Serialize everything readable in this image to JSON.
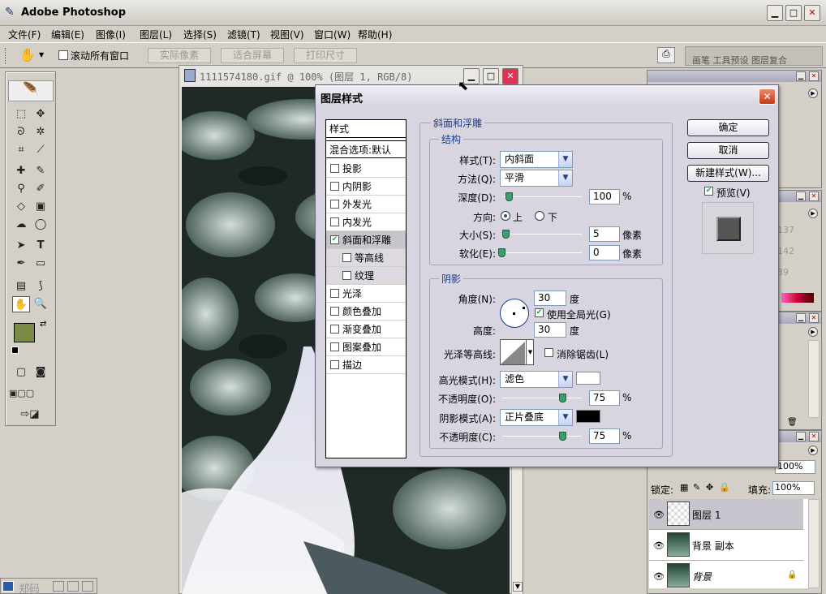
{
  "app": {
    "title": "Adobe Photoshop"
  },
  "menu": [
    "文件(F)",
    "编辑(E)",
    "图像(I)",
    "图层(L)",
    "选择(S)",
    "滤镜(T)",
    "视图(V)",
    "窗口(W)",
    "帮助(H)"
  ],
  "options": {
    "scroll_all": "滚动所有窗口",
    "actual_pixels": "实际像素",
    "fit_screen": "适合屏幕",
    "print_size": "打印尺寸"
  },
  "palette_tabs": "画笔 工具预设 图层复合",
  "document": {
    "title": "1111574180.gif @ 100% (图层 1, RGB/8)"
  },
  "dialog": {
    "title": "图层样式",
    "styles_header": "样式",
    "blend_options": "混合选项:默认",
    "effects": [
      {
        "label": "投影",
        "checked": false
      },
      {
        "label": "内阴影",
        "checked": false
      },
      {
        "label": "外发光",
        "checked": false
      },
      {
        "label": "内发光",
        "checked": false
      },
      {
        "label": "斜面和浮雕",
        "checked": true
      },
      {
        "label": "等高线",
        "checked": false
      },
      {
        "label": "纹理",
        "checked": false
      },
      {
        "label": "光泽",
        "checked": false
      },
      {
        "label": "颜色叠加",
        "checked": false
      },
      {
        "label": "渐变叠加",
        "checked": false
      },
      {
        "label": "图案叠加",
        "checked": false
      },
      {
        "label": "描边",
        "checked": false
      }
    ],
    "section_title": "斜面和浮雕",
    "structure": {
      "title": "结构",
      "style_label": "样式(T):",
      "style_value": "内斜面",
      "technique_label": "方法(Q):",
      "technique_value": "平滑",
      "depth_label": "深度(D):",
      "depth_value": "100",
      "depth_unit": "%",
      "direction_label": "方向:",
      "dir_up": "上",
      "dir_down": "下",
      "size_label": "大小(S):",
      "size_value": "5",
      "size_unit": "像素",
      "soften_label": "软化(E):",
      "soften_value": "0",
      "soften_unit": "像素"
    },
    "shading": {
      "title": "阴影",
      "angle_label": "角度(N):",
      "angle_value": "30",
      "angle_unit": "度",
      "global_light": "使用全局光(G)",
      "altitude_label": "高度:",
      "altitude_value": "30",
      "altitude_unit": "度",
      "gloss_label": "光泽等高线:",
      "anti_alias": "消除锯齿(L)",
      "highlight_label": "高光模式(H):",
      "highlight_value": "滤色",
      "hl_opacity_label": "不透明度(O):",
      "hl_opacity_value": "75",
      "hl_opacity_unit": "%",
      "shadow_label": "阴影模式(A):",
      "shadow_value": "正片叠底",
      "sh_opacity_label": "不透明度(C):",
      "sh_opacity_value": "75",
      "sh_opacity_unit": "%"
    },
    "buttons": {
      "ok": "确定",
      "cancel": "取消",
      "new_style": "新建样式(W)...",
      "preview": "预览(V)"
    }
  },
  "layers": {
    "lock_label": "锁定:",
    "fill_label": "填充:",
    "fill_value": "100%",
    "opacity_value": "100%",
    "items": [
      "图层 1",
      "背景 副本",
      "背景"
    ]
  },
  "swatch_values": [
    "137",
    "142",
    "39"
  ],
  "taskbar": {
    "ime": "郑码"
  },
  "colors": {
    "foreground": "#7c8a48",
    "dialog_bg": "#d8d4e0",
    "legend": "#1c3c8c"
  }
}
